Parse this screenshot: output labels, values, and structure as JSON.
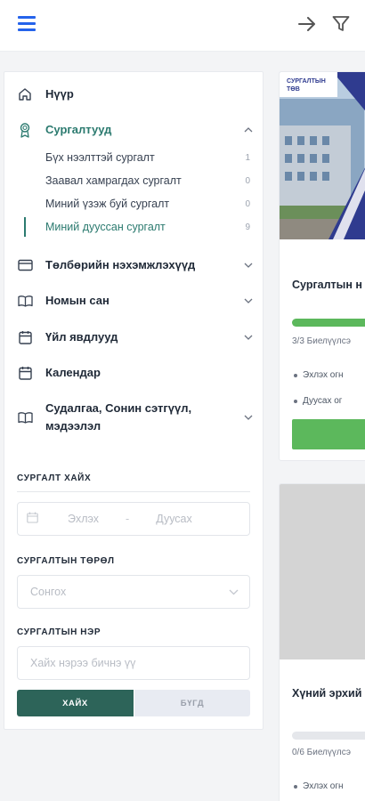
{
  "colors": {
    "accent": "#2b7a6f",
    "primary_blue": "#2563eb",
    "search_button": "#2d6459",
    "progress_green": "#5cb85c"
  },
  "topbar": {
    "menu_icon": "hamburger-icon",
    "right_icons": [
      "arrow-right-icon",
      "filter-icon"
    ]
  },
  "nav": {
    "home": "Нүүр",
    "trainings": "Сургалтууд",
    "trainings_sub": [
      {
        "label": "Бүх нээлттэй сургалт",
        "count": "1"
      },
      {
        "label": "Заавал хамрагдах сургалт",
        "count": "0"
      },
      {
        "label": "Миний үзэж буй сургалт",
        "count": "0"
      },
      {
        "label": "Миний дууссан сургалт",
        "count": "9"
      }
    ],
    "payments": "Төлбөрийн нэхэмжлэхүүд",
    "library": "Номын сан",
    "events": "Үйл явдлууд",
    "calendar": "Календар",
    "research_line1": "Судалгаа, Сонин сэтгүүл,",
    "research_line2": "мэдээлэл"
  },
  "filters": {
    "search_title": "СУРГАЛТ ХАЙХ",
    "date_start_placeholder": "Эхлэх",
    "date_separator": "-",
    "date_end_placeholder": "Дуусах",
    "type_label": "СУРГАЛТЫН ТӨРӨЛ",
    "type_placeholder": "Сонгох",
    "name_label": "СУРГАЛТЫН НЭР",
    "name_placeholder": "Хайх нэрээ бичнэ үү",
    "search_button": "ХАЙХ",
    "all_button": "БҮГД"
  },
  "cards": [
    {
      "image_caption_line1": "СУРГАЛТЫН",
      "image_caption_line2": "ТӨВ",
      "title": "Сургалтын н",
      "progress_label": "3/3 Биелүүлсэ",
      "progress": 1.0,
      "bullets": [
        "Эхлэх огн",
        "Дуусах ог"
      ]
    },
    {
      "title": "Хүний эрхий",
      "progress_label": "0/6 Биелүүлсэ",
      "progress": 0.0,
      "bullets": [
        "Эхлэх огн"
      ]
    }
  ]
}
